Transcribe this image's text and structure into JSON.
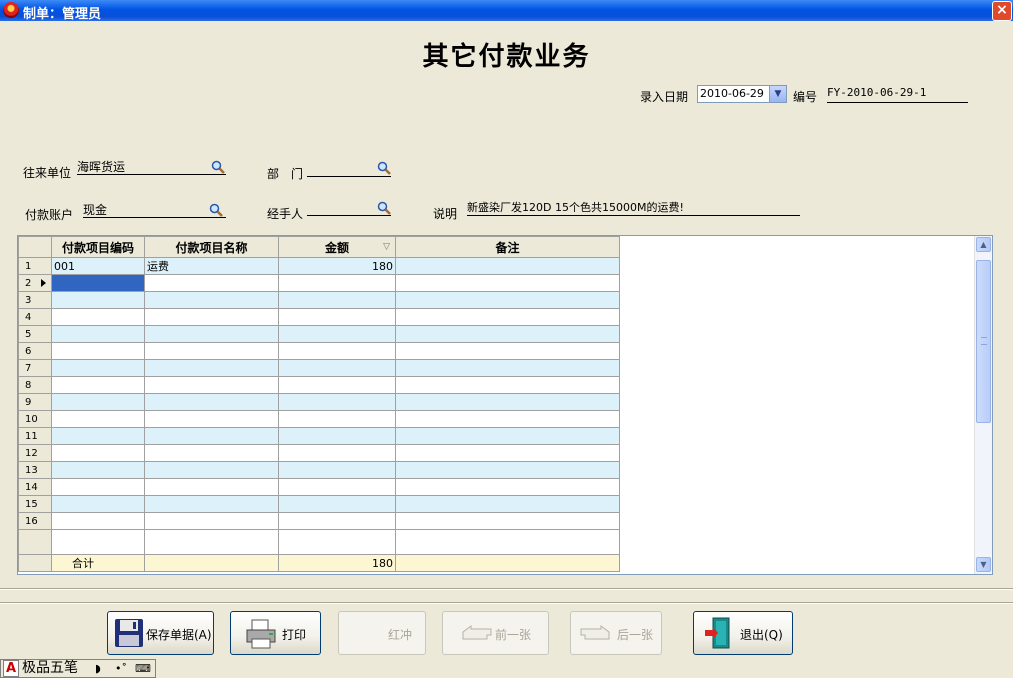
{
  "window": {
    "title": "制单：管理员",
    "close_label": "×"
  },
  "form": {
    "title": "其它付款业务"
  },
  "header": {
    "date_label": "录入日期",
    "date_value": "2010-06-29",
    "number_label": "编号",
    "number_value": "FY-2010-06-29-1"
  },
  "fields": {
    "partner_label": "往来单位",
    "partner_value": "海晖货运",
    "dept_label": "部　门",
    "dept_value": "",
    "account_label": "付款账户",
    "account_value": "现金",
    "handler_label": "经手人",
    "handler_value": "",
    "note_label": "说明",
    "note_value": "新盛染厂发120D 15个色共15000M的运费!"
  },
  "grid": {
    "columns": [
      "付款项目编码",
      "付款项目名称",
      "金额",
      "备注"
    ],
    "rows": [
      {
        "no": "1",
        "code": "001",
        "name": "运费",
        "amount": "180",
        "remark": ""
      },
      {
        "no": "2",
        "code": "",
        "name": "",
        "amount": "",
        "remark": ""
      },
      {
        "no": "3",
        "code": "",
        "name": "",
        "amount": "",
        "remark": ""
      },
      {
        "no": "4",
        "code": "",
        "name": "",
        "amount": "",
        "remark": ""
      },
      {
        "no": "5",
        "code": "",
        "name": "",
        "amount": "",
        "remark": ""
      },
      {
        "no": "6",
        "code": "",
        "name": "",
        "amount": "",
        "remark": ""
      },
      {
        "no": "7",
        "code": "",
        "name": "",
        "amount": "",
        "remark": ""
      },
      {
        "no": "8",
        "code": "",
        "name": "",
        "amount": "",
        "remark": ""
      },
      {
        "no": "9",
        "code": "",
        "name": "",
        "amount": "",
        "remark": ""
      },
      {
        "no": "10",
        "code": "",
        "name": "",
        "amount": "",
        "remark": ""
      },
      {
        "no": "11",
        "code": "",
        "name": "",
        "amount": "",
        "remark": ""
      },
      {
        "no": "12",
        "code": "",
        "name": "",
        "amount": "",
        "remark": ""
      },
      {
        "no": "13",
        "code": "",
        "name": "",
        "amount": "",
        "remark": ""
      },
      {
        "no": "14",
        "code": "",
        "name": "",
        "amount": "",
        "remark": ""
      },
      {
        "no": "15",
        "code": "",
        "name": "",
        "amount": "",
        "remark": ""
      },
      {
        "no": "16",
        "code": "",
        "name": "",
        "amount": "",
        "remark": ""
      }
    ],
    "footer": {
      "label": "合计",
      "amount": "180"
    }
  },
  "buttons": {
    "save": "保存单据(A)",
    "print": "打印",
    "reverse": "红冲",
    "prev": "前一张",
    "next": "后一张",
    "exit": "退出(Q)"
  },
  "ime": {
    "name": "极品五笔"
  }
}
